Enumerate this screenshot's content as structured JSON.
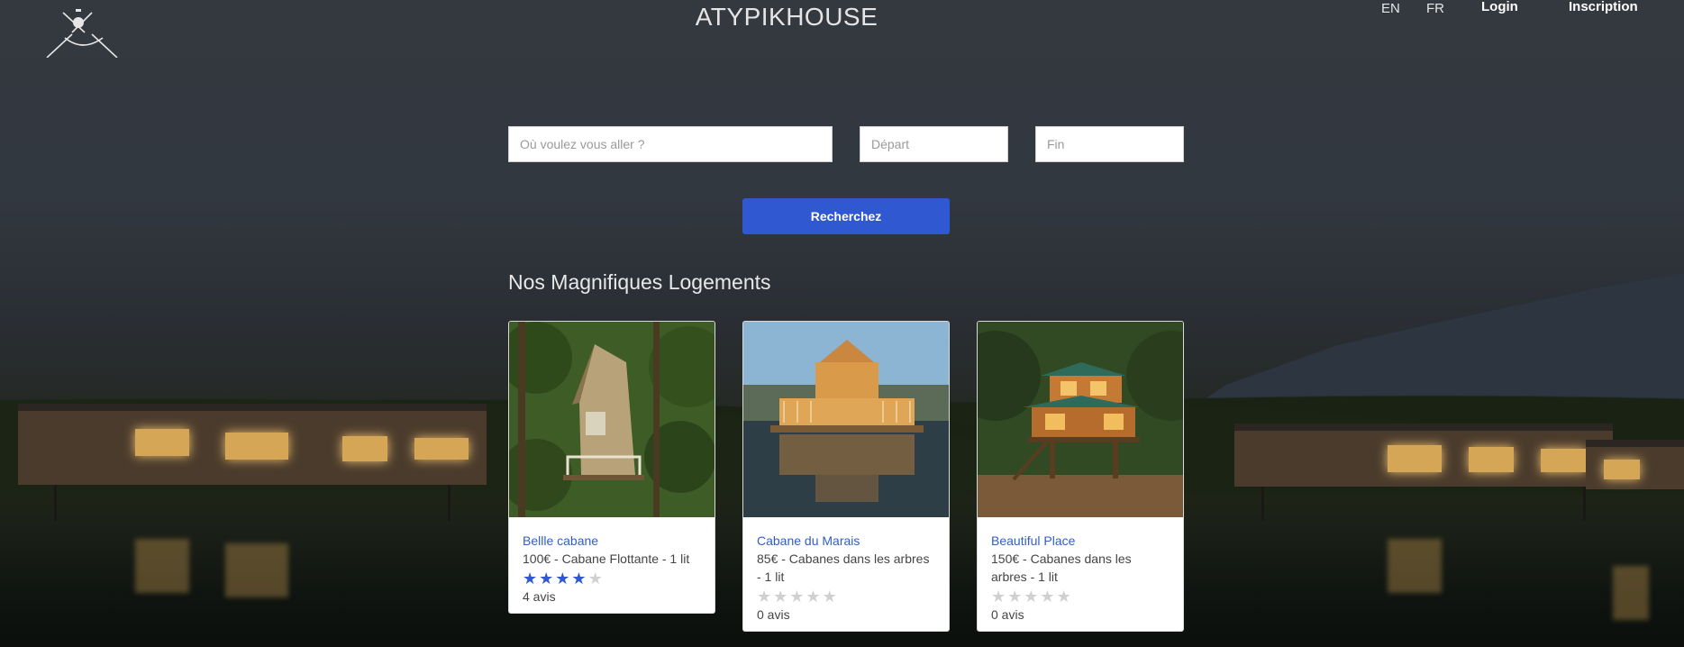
{
  "header": {
    "brand": "ATYPIKHOUSE",
    "lang_en": "EN",
    "lang_fr": "FR",
    "login": "Login",
    "signup": "Inscription"
  },
  "search": {
    "where_placeholder": "Où voulez vous aller ?",
    "start_placeholder": "Départ",
    "end_placeholder": "Fin",
    "button": "Recherchez"
  },
  "listings": {
    "title": "Nos Magnifiques Logements",
    "items": [
      {
        "name": "Bellle cabane",
        "description": "100€ - Cabane Flottante - 1 lit",
        "rating": 4,
        "max_rating": 5,
        "reviews": "4 avis"
      },
      {
        "name": "Cabane du Marais",
        "description": "85€ - Cabanes dans les arbres - 1 lit",
        "rating": 0,
        "max_rating": 5,
        "reviews": "0 avis"
      },
      {
        "name": "Beautiful Place",
        "description": "150€ - Cabanes dans les arbres - 1 lit",
        "rating": 0,
        "max_rating": 5,
        "reviews": "0 avis"
      }
    ]
  },
  "colors": {
    "accent": "#3058d0",
    "link": "#2f5fc4",
    "star_off": "#d0d0d0"
  }
}
